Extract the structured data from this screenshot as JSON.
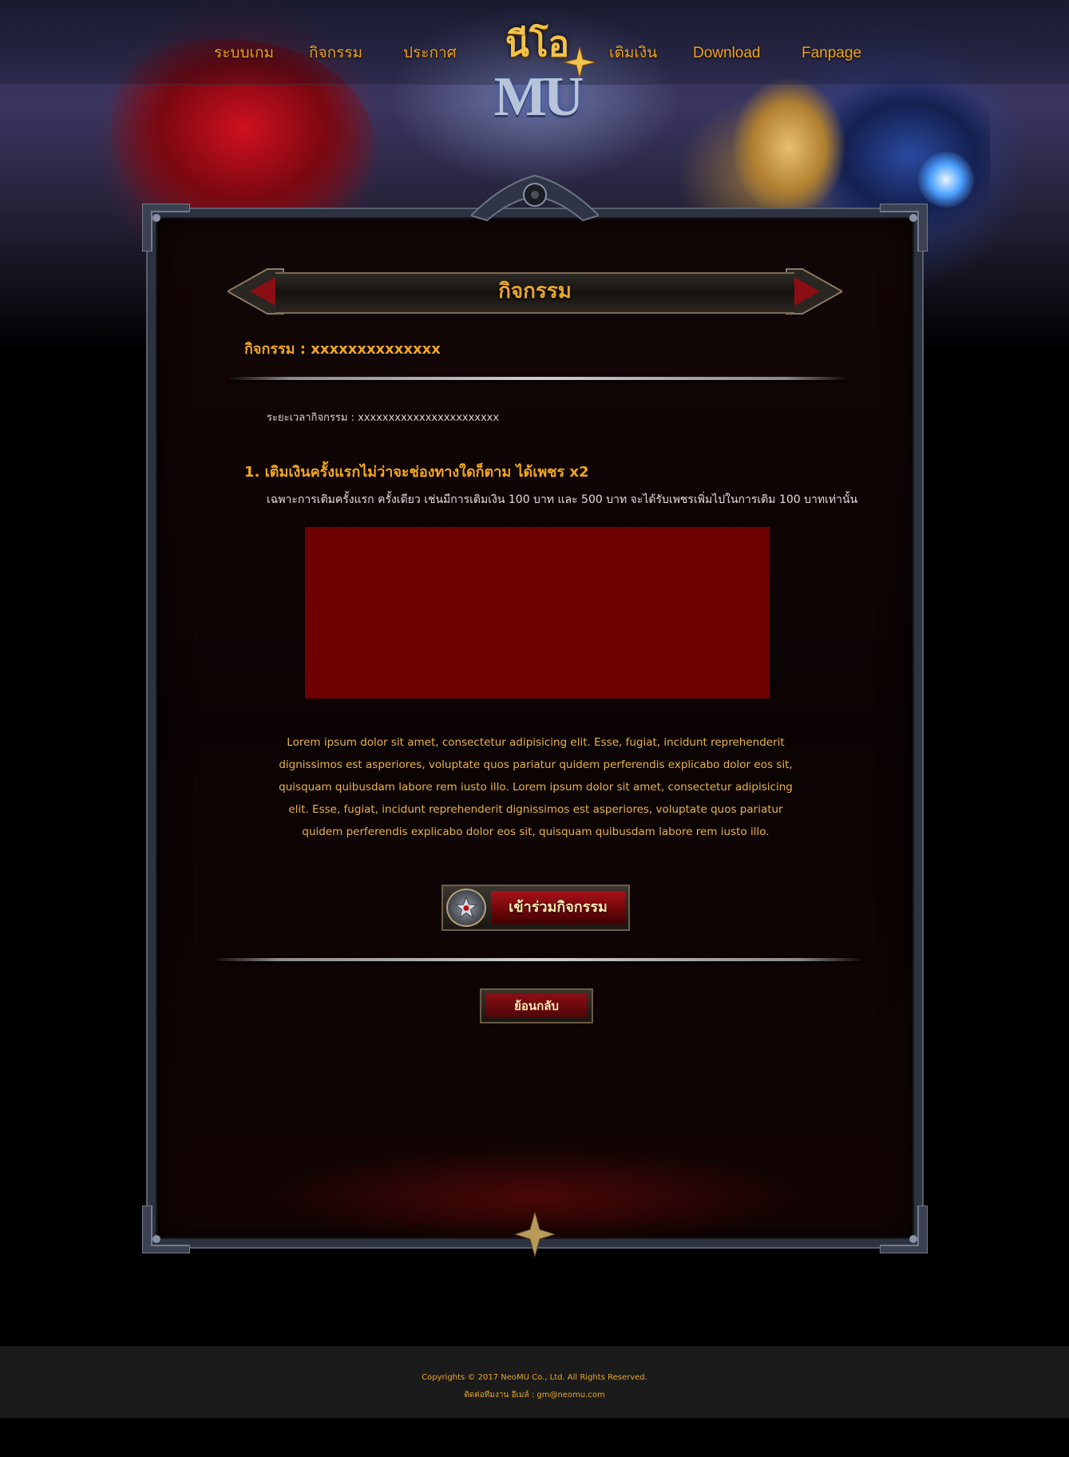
{
  "nav": {
    "items": [
      "ระบบเกม",
      "กิจกรรม",
      "ประกาศ",
      "เติมเงิน",
      "Download",
      "Fanpage"
    ]
  },
  "logo": {
    "top": "นีโอ",
    "bottom": "MU"
  },
  "page": {
    "title": "กิจกรรม",
    "event_heading": "กิจกรรม : xxxxxxxxxxxxxx",
    "period": "ระยะเวลากิจกรรม : xxxxxxxxxxxxxxxxxxxxxxx",
    "item_title": "1. เติมเงินครั้งแรกไม่ว่าจะช่องทางใดก็ตาม ได้เพชร x2",
    "item_desc": "เฉพาะการเติมครั้งแรก ครั้งเดียว เช่นมีการเติมเงิน 100 บาท และ 500 บาท จะได้รับเพชรเพิ่มไปในการเติม 100 บาทเท่านั้น",
    "lorem": "Lorem ipsum dolor sit amet, consectetur adipisicing elit. Esse, fugiat, incidunt reprehenderit dignissimos est asperiores, voluptate quos pariatur quidem perferendis explicabo dolor eos sit, quisquam quibusdam labore rem iusto illo. Lorem ipsum dolor sit amet, consectetur adipisicing elit. Esse, fugiat, incidunt reprehenderit dignissimos est asperiores, voluptate quos pariatur quidem perferendis explicabo dolor eos sit, quisquam quibusdam labore rem iusto illo.",
    "join_button": "เข้าร่วมกิจกรรม",
    "back_button": "ย้อนกลับ"
  },
  "footer": {
    "copyright": "Copyrights © 2017 NeoMU Co., Ltd. All Rights Reserved.",
    "contact": "ติดต่อทีมงาน อีเมล์ : gm@neomu.com"
  },
  "colors": {
    "accent": "#f0a31e",
    "placeholder": "#6e0000",
    "footer_bg": "#1b1b1b"
  },
  "icons": [
    "star-emblem-icon",
    "logo-star-icon",
    "frame-crest-icon",
    "corner-ornament-icon"
  ]
}
